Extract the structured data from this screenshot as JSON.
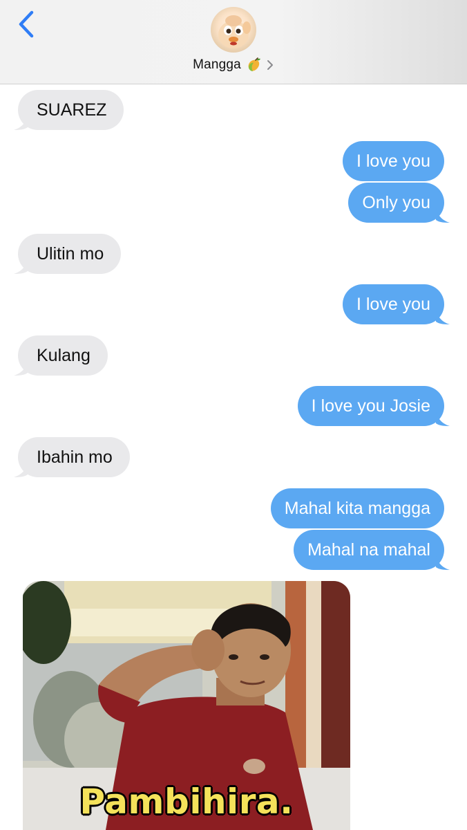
{
  "header": {
    "contact_name": "Mangga",
    "contact_emoji_icon": "mango-icon",
    "back_icon": "chevron-left-icon",
    "details_icon": "chevron-right-icon",
    "accent_color": "#2f7df6"
  },
  "messages": [
    {
      "direction": "incoming",
      "text": "SUAREZ"
    },
    {
      "direction": "outgoing",
      "text": "I love you"
    },
    {
      "direction": "outgoing",
      "text": "Only you"
    },
    {
      "direction": "incoming",
      "text": "Ulitin mo"
    },
    {
      "direction": "outgoing",
      "text": "I love you"
    },
    {
      "direction": "incoming",
      "text": "Kulang"
    },
    {
      "direction": "outgoing",
      "text": "I love you Josie"
    },
    {
      "direction": "incoming",
      "text": "Ibahin mo"
    },
    {
      "direction": "outgoing",
      "text": "Mahal kita mangga"
    },
    {
      "direction": "outgoing",
      "text": "Mahal na mahal"
    },
    {
      "direction": "incoming",
      "type": "image",
      "caption": "Pambihira."
    }
  ],
  "colors": {
    "incoming_bubble": "#e9e9eb",
    "outgoing_bubble": "#5ba8f2",
    "caption_text": "#f4e25a"
  }
}
